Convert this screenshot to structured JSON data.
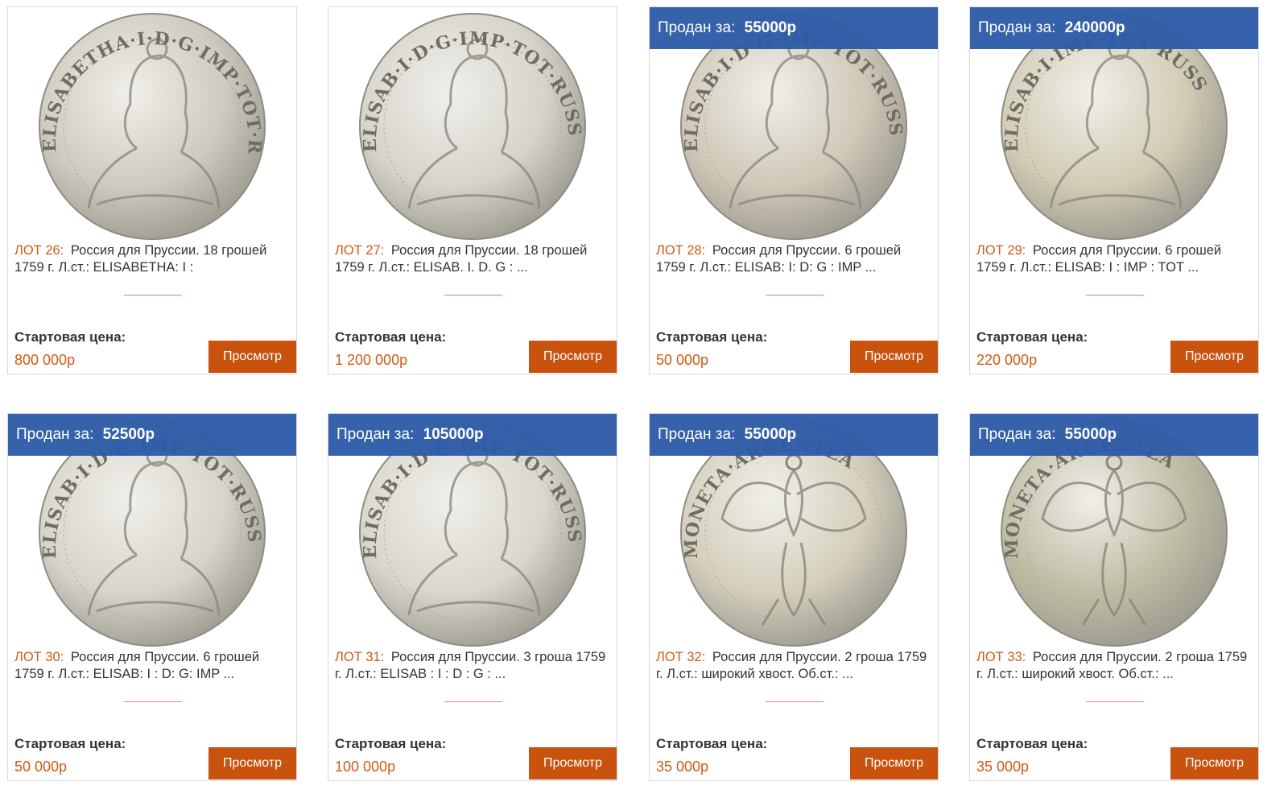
{
  "labels": {
    "start_price": "Стартовая цена:",
    "view_button": "Просмотр",
    "sold_prefix": "Продан за:"
  },
  "lots": [
    {
      "lot": "ЛОТ 26:",
      "desc": "Россия для Пруссии. 18 грошей 1759 г. Л.ст.: ELISABETHA: I :",
      "start_price": "800 000р",
      "sold": null,
      "legend": "ELISABETHA·I·D·G·IMP·TOT·ROSS:",
      "side": "portrait"
    },
    {
      "lot": "ЛОТ 27:",
      "desc": "Россия для Пруссии. 18 грошей 1759 г. Л.ст.: ELISAB. I. D. G : ...",
      "start_price": "1 200 000р",
      "sold": null,
      "legend": "ELISAB·I·D·G·IMP·TOT·RUSS",
      "side": "portrait"
    },
    {
      "lot": "ЛОТ 28:",
      "desc": "Россия для Пруссии. 6 грошей 1759 г. Л.ст.: ELISAB: I: D: G : IMP ...",
      "start_price": "50 000р",
      "sold": "55000р",
      "legend": "ELISAB·I·D·G·IMP·TOT·RUSS",
      "side": "portrait"
    },
    {
      "lot": "ЛОТ 29:",
      "desc": "Россия для Пруссии. 6 грошей 1759 г. Л.ст.: ELISAB: I : IMP : TOT ...",
      "start_price": "220 000р",
      "sold": "240000р",
      "legend": "ELISAB·I·IMP·TOT·RUSS",
      "side": "portrait"
    },
    {
      "lot": "ЛОТ 30:",
      "desc": "Россия для Пруссии. 6 грошей 1759 г. Л.ст.: ELISAB: I : D: G: IMP ...",
      "start_price": "50 000р",
      "sold": "52500р",
      "legend": "ELISAB·I·D·G·IMP·TOT·RUSS",
      "side": "portrait"
    },
    {
      "lot": "ЛОТ 31:",
      "desc": "Россия для Пруссии. 3 гроша 1759 г. Л.ст.: ELISAB : I : D : G : ...",
      "start_price": "100 000р",
      "sold": "105000р",
      "legend": "ELISAB·I·D·G·IMP·TOT·RUSS",
      "side": "portrait"
    },
    {
      "lot": "ЛОТ 32:",
      "desc": "Россия для Пруссии. 2 гроша 1759 г. Л.ст.: широкий хвост. Об.ст.: ...",
      "start_price": "35 000р",
      "sold": "55000р",
      "legend": "MONETA·ARGENTEA",
      "side": "eagle"
    },
    {
      "lot": "ЛОТ 33:",
      "desc": "Россия для Пруссии. 2 гроша 1759 г. Л.ст.: широкий хвост. Об.ст.: ...",
      "start_price": "35 000р",
      "sold": "55000р",
      "legend": "MONETA·ARGENTEA",
      "side": "eagle"
    }
  ],
  "colors": {
    "accent_orange": "#d05a14",
    "button_orange": "#c8520e",
    "sold_banner_blue": "#2e5ca8"
  }
}
